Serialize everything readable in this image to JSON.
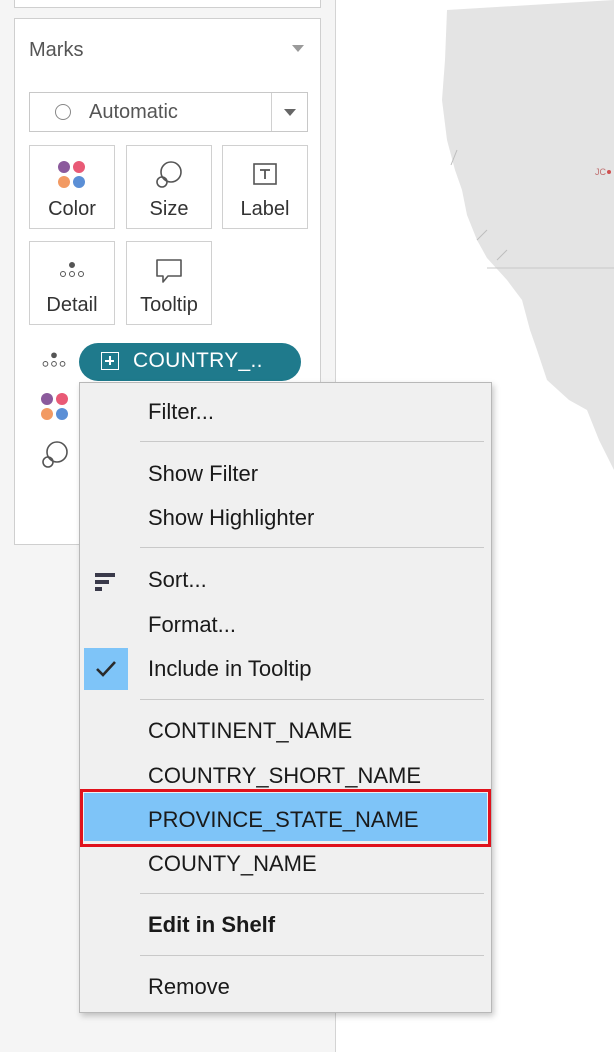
{
  "marks_card": {
    "title": "Marks",
    "mark_type": "Automatic"
  },
  "mark_buttons": [
    {
      "label": "Color",
      "icon": "color-dots-icon"
    },
    {
      "label": "Size",
      "icon": "size-icon"
    },
    {
      "label": "Label",
      "icon": "label-icon"
    },
    {
      "label": "Detail",
      "icon": "detail-icon"
    },
    {
      "label": "Tooltip",
      "icon": "tooltip-icon"
    }
  ],
  "field_pill": {
    "label": "COUNTRY_..",
    "icon": "plus-box-icon"
  },
  "context_menu": {
    "items": [
      {
        "label": "Filter..."
      },
      {
        "label": "Show Filter"
      },
      {
        "label": "Show Highlighter"
      },
      {
        "label": "Sort...",
        "icon": "sort-icon"
      },
      {
        "label": "Format..."
      },
      {
        "label": "Include in Tooltip",
        "checked": true
      },
      {
        "label": "CONTINENT_NAME"
      },
      {
        "label": "COUNTRY_SHORT_NAME"
      },
      {
        "label": "PROVINCE_STATE_NAME",
        "highlighted": true
      },
      {
        "label": "COUNTY_NAME"
      },
      {
        "label": "Edit in Shelf",
        "bold": true
      },
      {
        "label": "Remove"
      }
    ]
  },
  "colors": {
    "pill": "#1f7a8c",
    "highlight": "#7ec4f8",
    "annotation_border": "#e0121c"
  }
}
